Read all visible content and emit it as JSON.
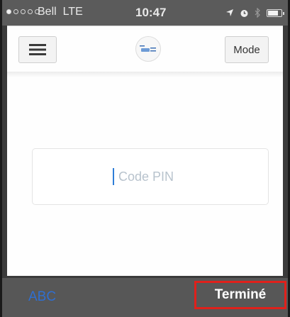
{
  "status_bar": {
    "carrier": "Bell",
    "network": "LTE",
    "time": "10:47",
    "signal_bars_filled": 1,
    "signal_bars_total": 5,
    "icons": [
      "location-arrow-icon",
      "alarm-icon",
      "bluetooth-icon",
      "battery-icon"
    ]
  },
  "toolbar": {
    "menu_icon": "hamburger-menu-icon",
    "logo_icon": "app-logo-icon",
    "mode_label": "Mode"
  },
  "pin_field": {
    "placeholder": "Code PIN",
    "value": ""
  },
  "keyboard_bar": {
    "abc_label": "ABC",
    "done_label": "Terminé"
  },
  "colors": {
    "accent_blue": "#2f6fd1",
    "highlight_red": "#e0201b",
    "status_bar": "#5b5b5b",
    "keyboard_bar": "#575757"
  }
}
